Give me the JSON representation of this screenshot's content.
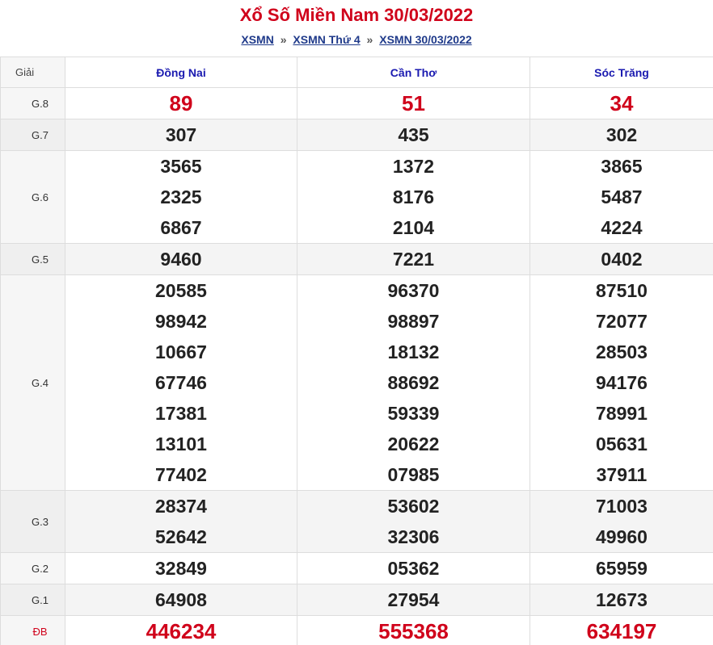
{
  "header": {
    "title": "Xổ Số Miền Nam 30/03/2022",
    "breadcrumb": {
      "items": [
        "XSMN",
        "XSMN Thứ 4",
        "XSMN 30/03/2022"
      ],
      "separator": "»"
    }
  },
  "table": {
    "label_header": "Giải",
    "provinces": [
      "Đồng Nai",
      "Cần Thơ",
      "Sóc Trăng"
    ],
    "prizes": [
      {
        "label": "G.8",
        "values": [
          [
            "89"
          ],
          [
            "51"
          ],
          [
            "34"
          ]
        ]
      },
      {
        "label": "G.7",
        "values": [
          [
            "307"
          ],
          [
            "435"
          ],
          [
            "302"
          ]
        ]
      },
      {
        "label": "G.6",
        "values": [
          [
            "3565",
            "2325",
            "6867"
          ],
          [
            "1372",
            "8176",
            "2104"
          ],
          [
            "3865",
            "5487",
            "4224"
          ]
        ]
      },
      {
        "label": "G.5",
        "values": [
          [
            "9460"
          ],
          [
            "7221"
          ],
          [
            "0402"
          ]
        ]
      },
      {
        "label": "G.4",
        "values": [
          [
            "20585",
            "98942",
            "10667",
            "67746",
            "17381",
            "13101",
            "77402"
          ],
          [
            "96370",
            "98897",
            "18132",
            "88692",
            "59339",
            "20622",
            "07985"
          ],
          [
            "87510",
            "72077",
            "28503",
            "94176",
            "78991",
            "05631",
            "37911"
          ]
        ]
      },
      {
        "label": "G.3",
        "values": [
          [
            "28374",
            "52642"
          ],
          [
            "53602",
            "32306"
          ],
          [
            "71003",
            "49960"
          ]
        ]
      },
      {
        "label": "G.2",
        "values": [
          [
            "32849"
          ],
          [
            "05362"
          ],
          [
            "65959"
          ]
        ]
      },
      {
        "label": "G.1",
        "values": [
          [
            "64908"
          ],
          [
            "27954"
          ],
          [
            "12673"
          ]
        ]
      },
      {
        "label": "ĐB",
        "values": [
          [
            "446234"
          ],
          [
            "555368"
          ],
          [
            "634197"
          ]
        ]
      }
    ]
  },
  "colors": {
    "accent_red": "#d0021b",
    "province_blue": "#1a1ab0",
    "link_blue": "#1f3a8a"
  }
}
